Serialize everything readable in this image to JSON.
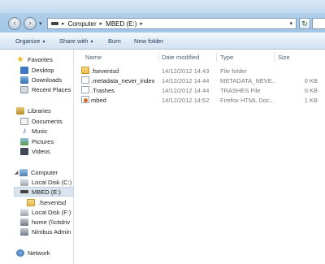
{
  "address": {
    "crumbs": [
      "Computer",
      "MBED (E:)"
    ],
    "separator": "▸"
  },
  "toolbar": {
    "organize": "Organize",
    "share_with": "Share with",
    "burn": "Burn",
    "new_folder": "New folder"
  },
  "navigation": {
    "favorites": "Favorites",
    "favorites_items": [
      "Desktop",
      "Downloads",
      "Recent Places"
    ],
    "libraries": "Libraries",
    "libraries_items": [
      "Documents",
      "Music",
      "Pictures",
      "Videos"
    ],
    "computer": "Computer",
    "computer_items": [
      "Local Disk (C:)",
      "MBED (E:)",
      ".fseventsd",
      "Local Disk (F:)",
      "home (\\\\citdriv",
      "Nimbus Admin"
    ],
    "network": "Network"
  },
  "columns": {
    "name": "Name",
    "date": "Date modified",
    "type": "Type",
    "size": "Size"
  },
  "files": [
    {
      "name": ".fseventsd",
      "date": "14/12/2012 14:43",
      "type": "File folder",
      "size": "",
      "icon": "folder-icon"
    },
    {
      "name": ".metadata_never_index",
      "date": "14/12/2012 14:44",
      "type": "METADATA_NEVE...",
      "size": "0 KB",
      "icon": "file-icon"
    },
    {
      "name": ".Trashes",
      "date": "14/12/2012 14:44",
      "type": "TRASHES File",
      "size": "0 KB",
      "icon": "file-icon"
    },
    {
      "name": "mbed",
      "date": "14/12/2012 14:52",
      "type": "Firefox HTML Doc...",
      "size": "1 KB",
      "icon": "html-file-icon"
    }
  ]
}
